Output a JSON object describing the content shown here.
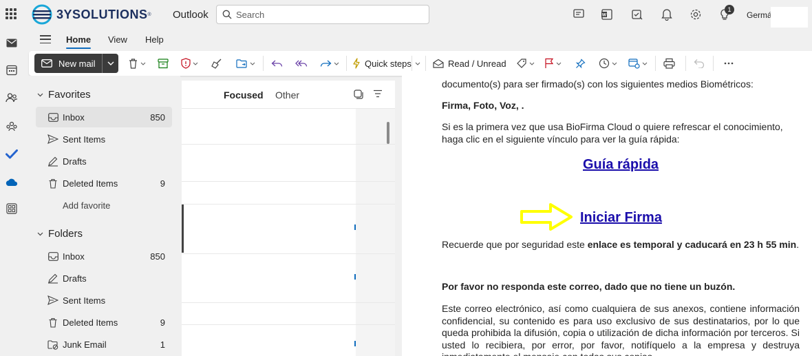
{
  "header": {
    "logo_text": "3YSOLUTIONS",
    "logo_reg": "®",
    "app_name": "Outlook",
    "search_placeholder": "Search",
    "notification_count": "1",
    "user_name": "Germá"
  },
  "ribbon": {
    "tabs": [
      {
        "label": "Home",
        "active": true
      },
      {
        "label": "View",
        "active": false
      },
      {
        "label": "Help",
        "active": false
      }
    ],
    "new_mail_label": "New mail",
    "quick_steps_label": "Quick steps",
    "read_unread_label": "Read / Unread"
  },
  "folders": {
    "favorites_label": "Favorites",
    "favorites": [
      {
        "label": "Inbox",
        "count": "850"
      },
      {
        "label": "Sent Items",
        "count": ""
      },
      {
        "label": "Drafts",
        "count": ""
      },
      {
        "label": "Deleted Items",
        "count": "9"
      }
    ],
    "add_favorite_label": "Add favorite",
    "folders_label": "Folders",
    "folder_items": [
      {
        "label": "Inbox",
        "count": "850"
      },
      {
        "label": "Drafts",
        "count": ""
      },
      {
        "label": "Sent Items",
        "count": ""
      },
      {
        "label": "Deleted Items",
        "count": "9"
      },
      {
        "label": "Junk Email",
        "count": "1"
      }
    ]
  },
  "message_list": {
    "tab_focused": "Focused",
    "tab_other": "Other"
  },
  "reading_pane": {
    "p1": "documento(s) para ser firmado(s) con los siguientes medios Biométricos:",
    "p2": "Firma, Foto, Voz, .",
    "p3": "Si es la primera vez que usa BioFirma Cloud o quiere refrescar el conocimiento, haga clic en el siguiente vínculo para ver la guía rápida:",
    "link_guide": "Guía rápida",
    "link_sign": "Iniciar Firma",
    "p4_start": "Recuerde que por seguridad este ",
    "p4_bold": "enlace es temporal y caducará en 23 h 55 min",
    "p4_end": ".",
    "p5": "Por favor no responda este correo, dado que no tiene un buzón.",
    "p6": "Este correo electrónico, así como cualquiera de sus anexos, contiene información confidencial, su contenido es para uso exclusivo de sus destinatarios, por lo que queda prohibida la difusión, copia o utilización de dicha información por terceros. Si usted lo recibiera, por error, por favor, notifíquelo a la empresa y destruya inmediatamente el mensaje con todas sus copias."
  },
  "colors": {
    "link": "#1a0dab",
    "accent": "#0f6cbd",
    "arrow": "#ffff00",
    "new_mail_bg": "#3b3b3b"
  }
}
